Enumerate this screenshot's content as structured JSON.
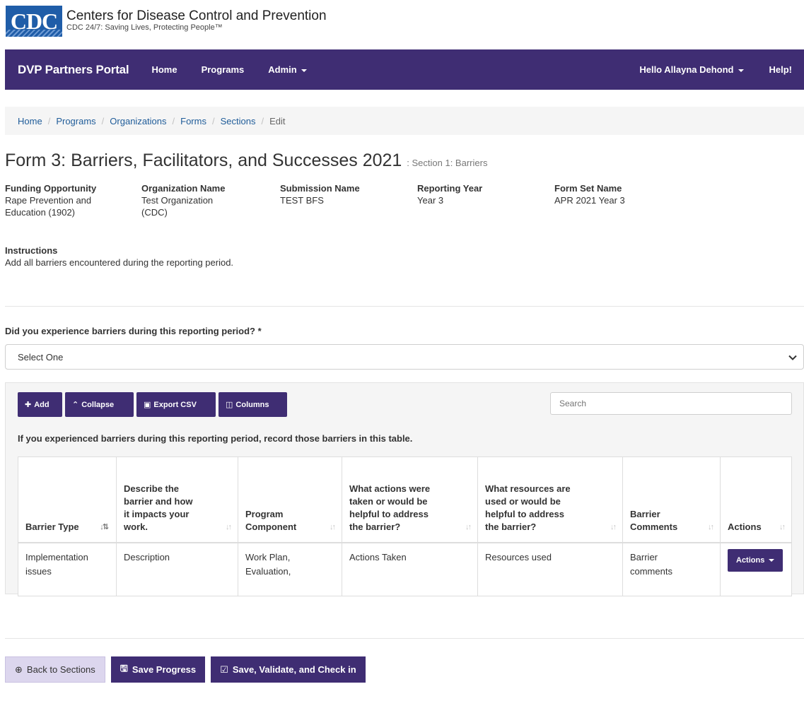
{
  "header": {
    "logo_text": "CDC",
    "org_title": "Centers for Disease Control and Prevention",
    "tagline": "CDC 24/7: Saving Lives, Protecting People™"
  },
  "navbar": {
    "brand": "DVP Partners Portal",
    "items": [
      "Home",
      "Programs",
      "Admin"
    ],
    "user": "Hello Allayna Dehond",
    "help": "Help!"
  },
  "breadcrumb": [
    "Home",
    "Programs",
    "Organizations",
    "Forms",
    "Sections",
    "Edit"
  ],
  "page": {
    "title": "Form 3: Barriers, Facilitators, and Successes 2021",
    "subtitle": ": Section 1: Barriers"
  },
  "meta": [
    {
      "label": "Funding Opportunity",
      "value_line1": "Rape Prevention and",
      "value_line2": "Education (1902)"
    },
    {
      "label": "Organization Name",
      "value_line1": "Test Organization",
      "value_line2": "(CDC)"
    },
    {
      "label": "Submission Name",
      "value_line1": "TEST BFS",
      "value_line2": ""
    },
    {
      "label": "Reporting Year",
      "value_line1": "Year 3",
      "value_line2": ""
    },
    {
      "label": "Form Set Name",
      "value_line1": "APR 2021 Year 3",
      "value_line2": ""
    }
  ],
  "instructions": {
    "label": "Instructions",
    "text": "Add all barriers encountered during the reporting period."
  },
  "question": {
    "label": "Did you experience barriers during this reporting period? *",
    "selected": "Select One"
  },
  "toolbar": {
    "add": "Add",
    "collapse": "Collapse",
    "export": "Export CSV",
    "columns": "Columns",
    "search_placeholder": "Search"
  },
  "table_note": "If you experienced barriers during this reporting period, record those barriers in this table.",
  "table": {
    "headers": [
      {
        "l1": "Barrier Type",
        "l2": "",
        "l3": "",
        "l4": ""
      },
      {
        "l1": "Describe the",
        "l2": "barrier and how",
        "l3": "it impacts your",
        "l4": "work."
      },
      {
        "l1": "Program",
        "l2": "Component",
        "l3": "",
        "l4": ""
      },
      {
        "l1": "What actions were",
        "l2": "taken or would be",
        "l3": "helpful to address",
        "l4": "the barrier?"
      },
      {
        "l1": "What resources are",
        "l2": "used or would be",
        "l3": "helpful to address",
        "l4": "the barrier?"
      },
      {
        "l1": "Barrier",
        "l2": "Comments",
        "l3": "",
        "l4": ""
      },
      {
        "l1": "Actions",
        "l2": "",
        "l3": "",
        "l4": ""
      }
    ],
    "rows": [
      {
        "barrier_type_l1": "Implementation",
        "barrier_type_l2": "issues",
        "description": "Description",
        "component_l1": "Work Plan,",
        "component_l2": "Evaluation,",
        "actions_taken": "Actions Taken",
        "resources": "Resources used",
        "comments_l1": "Barrier",
        "comments_l2": "comments",
        "actions_button": "Actions"
      }
    ]
  },
  "footer": {
    "back": "Back to Sections",
    "save": "Save Progress",
    "save_validate": "Save, Validate, and Check in"
  },
  "colors": {
    "brand_purple": "#3f2d73",
    "cdc_blue": "#1f5da8",
    "link_blue": "#1f5c99",
    "light_button": "#dcd6ee"
  }
}
